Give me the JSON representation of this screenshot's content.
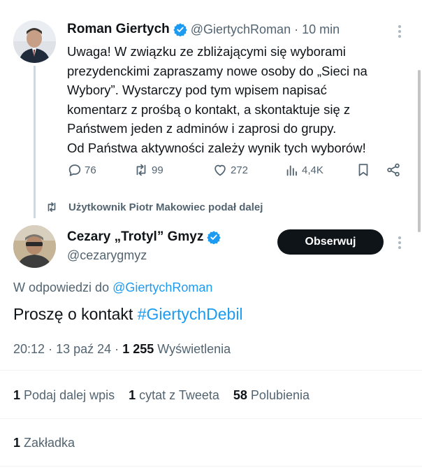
{
  "tweet1": {
    "author_name": "Roman Giertych",
    "handle": "@GiertychRoman",
    "separator": "·",
    "time": "10 min",
    "text_lines": [
      "Uwaga! W związku ze zbliżającymi się wyborami",
      "prezydenckimi zapraszamy nowe osoby do „Sieci na",
      "Wybory”. Wystarczy pod tym wpisem napisać",
      "komentarz z prośbą o kontakt, a skontaktuje się z",
      "Państwem jeden z adminów i zaprosi do grupy.",
      "Od Państwa aktywności zależy wynik tych wyborów!"
    ],
    "actions": {
      "replies": "76",
      "reposts": "99",
      "likes": "272",
      "views": "4,4K"
    }
  },
  "retweet_note": "Użytkownik Piotr Makowiec podał dalej",
  "tweet2": {
    "author_name": "Cezary „Trotyl” Gmyz",
    "handle": "@cezarygmyz",
    "follow_label": "Obserwuj",
    "reply_prefix": "W odpowiedzi do",
    "reply_to": "@GiertychRoman",
    "text": "Proszę o kontakt ",
    "hashtag": "#GiertychDebil",
    "time": "20:12",
    "date": "13 paź 24",
    "dot": "·",
    "views_count": "1 255",
    "views_label": "Wyświetlenia"
  },
  "stats": {
    "reposts_count": "1",
    "reposts_label": "Podaj dalej wpis",
    "quotes_count": "1",
    "quotes_label": "cytat z Tweeta",
    "likes_count": "58",
    "likes_label": "Polubienia",
    "bookmarks_count": "1",
    "bookmarks_label": "Zakładka"
  },
  "colors": {
    "accent": "#1d9bf0",
    "text_primary": "#0f1419",
    "text_secondary": "#536471",
    "button_dark": "#0f1419"
  }
}
